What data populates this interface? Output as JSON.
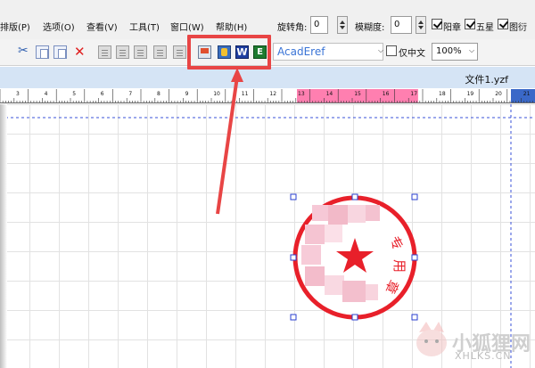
{
  "menu": {
    "items": [
      "排版(P)",
      "选项(O)",
      "查看(V)",
      "工具(T)",
      "窗口(W)",
      "帮助(H)"
    ]
  },
  "properties": {
    "rotation_label": "旋转角:",
    "rotation_value": "0",
    "blur_label": "模糊度:",
    "blur_value": "0",
    "checks": [
      {
        "label": "阳章",
        "checked": true
      },
      {
        "label": "五星",
        "checked": true
      },
      {
        "label": "图衍",
        "checked": true
      }
    ]
  },
  "toolbar": {
    "font_value": "AcadEref",
    "chinese_only_label": "仅中文",
    "chinese_only_checked": false,
    "zoom_value": "100%"
  },
  "document": {
    "title": "文件1.yzf"
  },
  "ruler": {
    "ticks": [
      "3",
      "4",
      "5",
      "6",
      "7",
      "8",
      "9",
      "10",
      "11",
      "12",
      "13",
      "14",
      "15",
      "16",
      "17",
      "18",
      "19",
      "20",
      "21"
    ],
    "highlight_color": "#ff7fb0"
  },
  "stamp": {
    "text": "专用章",
    "color": "#e8202a",
    "star": "★"
  },
  "watermark": {
    "text": "小狐狸网",
    "url": "XHLKS.CN"
  },
  "colors": {
    "annotation": "#e84545",
    "selection_handle": "#2a3fcf"
  }
}
